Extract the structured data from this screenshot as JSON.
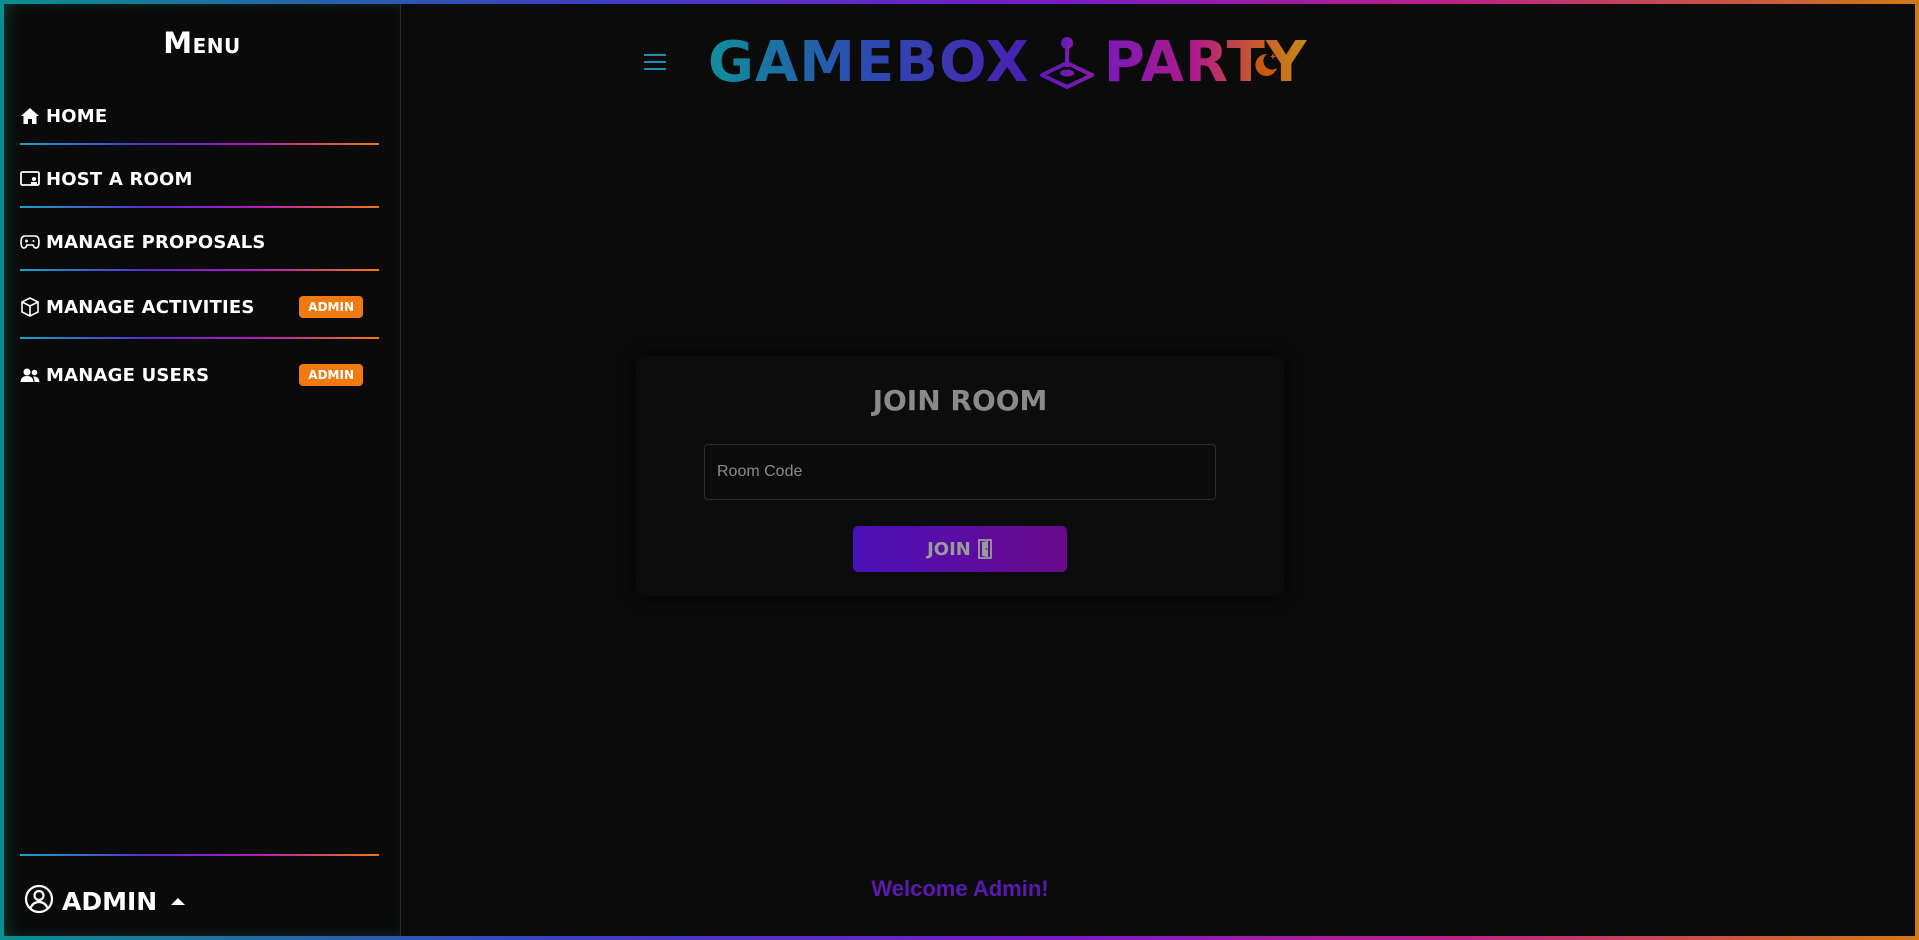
{
  "sidebar": {
    "title": "Menu",
    "items": [
      {
        "label": "HOME",
        "icon": "home-icon"
      },
      {
        "label": "HOST A ROOM",
        "icon": "host-room-icon"
      },
      {
        "label": "MANAGE PROPOSALS",
        "icon": "gamepad-icon"
      },
      {
        "label": "MANAGE ACTIVITIES",
        "icon": "box-icon",
        "badge": "ADMIN"
      },
      {
        "label": "MANAGE USERS",
        "icon": "users-icon",
        "badge": "ADMIN"
      }
    ],
    "user": {
      "label": "ADMIN",
      "icon": "user-circle-icon"
    }
  },
  "header": {
    "logo_part1": "GAMEBOX",
    "logo_part2": "PARTY",
    "logo_icon": "joystick-icon",
    "menu_icon": "hamburger-icon",
    "theme_icon": "moon-icon"
  },
  "join_card": {
    "title": "JOIN ROOM",
    "input_placeholder": "Room Code",
    "input_value": "",
    "button_label": "JOIN",
    "button_icon": "door-icon"
  },
  "footer": {
    "welcome": "Welcome Admin!"
  },
  "colors": {
    "badge": "#f07a10",
    "accent_purple": "#4a10b8",
    "accent_teal": "#0f8f9a",
    "welcome": "#5a1ab0"
  }
}
